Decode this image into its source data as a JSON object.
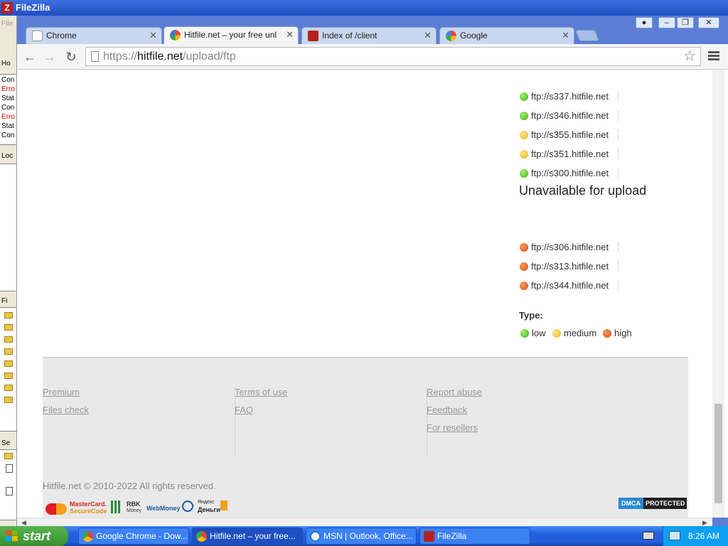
{
  "filezilla": {
    "title": "FileZilla",
    "log_lines": [
      {
        "text": "Con",
        "error": false
      },
      {
        "text": "Erro",
        "error": true
      },
      {
        "text": "Stat",
        "error": false
      },
      {
        "text": "Con",
        "error": false
      },
      {
        "text": "Erro",
        "error": true
      },
      {
        "text": "Stat",
        "error": false
      },
      {
        "text": "Con",
        "error": false
      }
    ],
    "file_label": "File",
    "host_label": "Ho",
    "local_label": "Loc",
    "fn_label": "Fi",
    "se_label": "Se"
  },
  "chrome": {
    "tabs": [
      {
        "label": "Chrome",
        "icon_color": "#c0c0c0"
      },
      {
        "label": "Hitfile.net – your free unlimited",
        "icon_color": "#e84a35"
      },
      {
        "label": "Index of /client",
        "icon_color": "#b3231e"
      },
      {
        "label": "Google",
        "icon_color": "#4285f4"
      }
    ],
    "url_scheme": "https://",
    "url_host": "hitfile.net",
    "url_path": "/upload/ftp"
  },
  "page": {
    "available_servers": [
      {
        "name": "ftp://s337.hitfile.net",
        "status": "green"
      },
      {
        "name": "ftp://s346.hitfile.net",
        "status": "green"
      },
      {
        "name": "ftp://s355.hitfile.net",
        "status": "yellow"
      },
      {
        "name": "ftp://s351.hitfile.net",
        "status": "yellow"
      },
      {
        "name": "ftp://s300.hitfile.net",
        "status": "green"
      }
    ],
    "unavailable_title": "Unavailable for upload",
    "unavailable_servers": [
      {
        "name": "ftp://s306.hitfile.net",
        "status": "orange"
      },
      {
        "name": "ftp://s313.hitfile.net",
        "status": "orange"
      },
      {
        "name": "ftp://s344.hitfile.net",
        "status": "orange"
      }
    ],
    "type_label": "Type:",
    "legend": {
      "low": "low",
      "medium": "medium",
      "high": "high"
    }
  },
  "footer": {
    "col1": [
      "Premium",
      "Files check"
    ],
    "col2": [
      "Terms of use",
      "FAQ"
    ],
    "col3": [
      "Report abuse",
      "Feedback",
      "For resellers"
    ],
    "copyright": "Hitfile.net © 2010-2022 All rights reserved.",
    "payment_logos": {
      "mastercard_line1": "MasterCard.",
      "mastercard_line2": "SecureCode",
      "rbk_line1": "RBK",
      "rbk_line2": "Money",
      "webmoney": "WebMoney",
      "yandex_line1": "Яндекс",
      "yandex_line2": "Деньги"
    },
    "dmca_prefix": "DMCA",
    "dmca_suffix": "PROTECTED"
  },
  "taskbar": {
    "start_label": "start",
    "tasks": [
      {
        "label": "Google Chrome - Dow...",
        "active": false
      },
      {
        "label": "Hitfile.net – your free...",
        "active": true
      },
      {
        "label": "MSN | Outlook, Office...",
        "active": false
      },
      {
        "label": "FileZilla",
        "active": false
      }
    ],
    "clock": "8:26 AM"
  },
  "colors": {
    "green": "#3fae1a",
    "yellow": "#e6b21d",
    "orange": "#d65214",
    "xp_blue": "#245edb"
  }
}
